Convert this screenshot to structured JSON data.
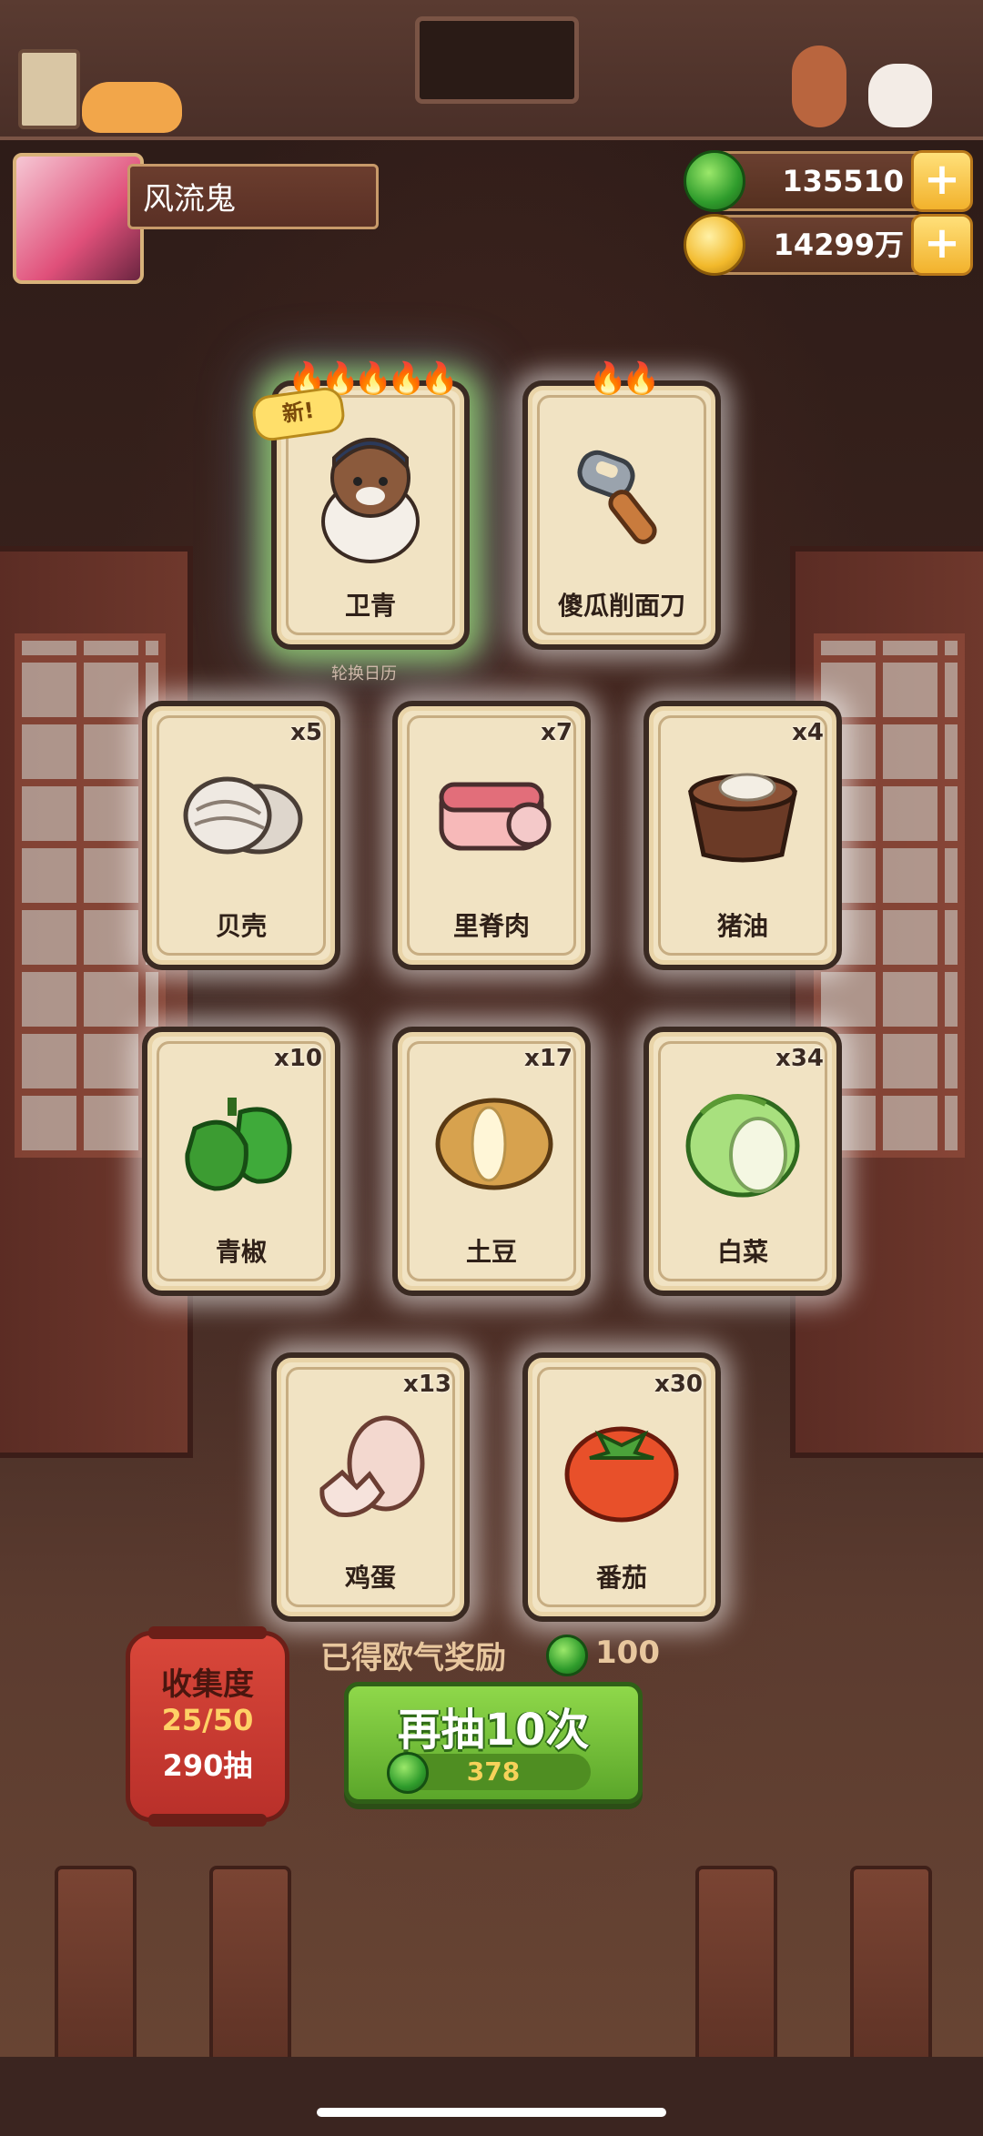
{
  "player": {
    "name": "风流鬼"
  },
  "currencies": {
    "jade": "135510",
    "gold": "14299万"
  },
  "special_cards": [
    {
      "name": "卫青",
      "flames": "🔥🔥🔥🔥🔥",
      "badge": "新!",
      "art_icon": "character-icon"
    },
    {
      "name": "傻瓜削面刀",
      "flames": "🔥🔥",
      "art_icon": "peeler-knife-icon"
    }
  ],
  "caption_below": "轮换日历",
  "item_cards": [
    {
      "name": "贝壳",
      "count": "x5",
      "art_icon": "shell-icon"
    },
    {
      "name": "里脊肉",
      "count": "x7",
      "art_icon": "meat-roll-icon"
    },
    {
      "name": "猪油",
      "count": "x4",
      "art_icon": "lard-bowl-icon"
    },
    {
      "name": "青椒",
      "count": "x10",
      "art_icon": "green-pepper-icon"
    },
    {
      "name": "土豆",
      "count": "x17",
      "art_icon": "potato-icon"
    },
    {
      "name": "白菜",
      "count": "x34",
      "art_icon": "cabbage-icon"
    },
    {
      "name": "鸡蛋",
      "count": "x13",
      "art_icon": "egg-icon"
    },
    {
      "name": "番茄",
      "count": "x30",
      "art_icon": "tomato-icon"
    }
  ],
  "luck_reward": {
    "label": "已得欧气奖励",
    "value": "100"
  },
  "draw_button": {
    "label": "再抽10次",
    "cost": "378"
  },
  "collection": {
    "title": "收集度",
    "progress": "25/50",
    "draws": "290抽"
  }
}
